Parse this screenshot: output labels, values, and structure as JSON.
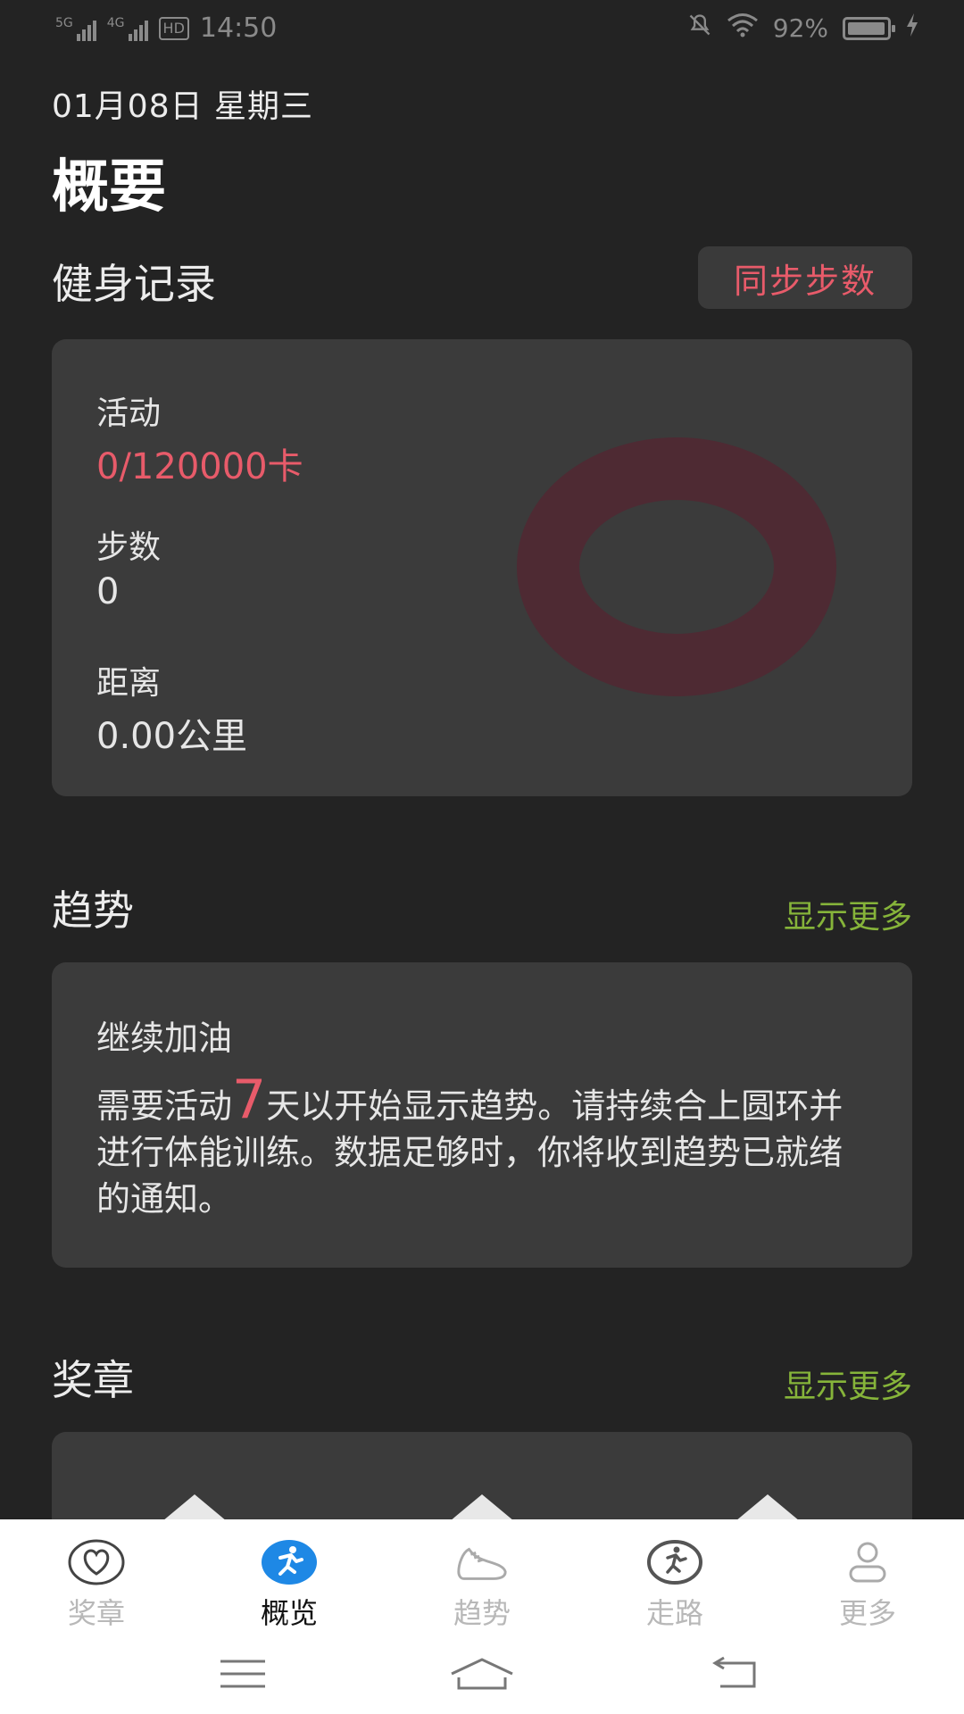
{
  "status_bar": {
    "time": "14:50",
    "network1": "5G",
    "network2": "4G",
    "hd": "HD",
    "battery": "92%"
  },
  "header": {
    "date": "01月08日  星期三",
    "title": "概要"
  },
  "fitness": {
    "section_title": "健身记录",
    "sync_button": "同步步数",
    "activity_label": "活动",
    "activity_value": "0/120000卡",
    "steps_label": "步数",
    "steps_value": "0",
    "distance_label": "距离",
    "distance_value": "0.00公里",
    "ring_color": "#4e2a33"
  },
  "trend": {
    "section_title": "趋势",
    "more_link": "显示更多",
    "card_title": "继续加油",
    "body_before": "需要活动",
    "body_number": "7",
    "body_after": "天以开始显示趋势。请持续合上圆环并进行体能训练。数据足够时，你将收到趋势已就绪的通知。"
  },
  "medals": {
    "section_title": "奖章",
    "more_link": "显示更多"
  },
  "tabbar": {
    "items": [
      {
        "label": "奖章",
        "icon": "heart-icon"
      },
      {
        "label": "概览",
        "icon": "runner-icon"
      },
      {
        "label": "趋势",
        "icon": "shoe-icon"
      },
      {
        "label": "走路",
        "icon": "walker-icon"
      },
      {
        "label": "更多",
        "icon": "person-icon"
      }
    ],
    "active_index": 1
  },
  "colors": {
    "accent_red": "#e85b6a",
    "accent_green": "#86b43a",
    "active_blue": "#1e88e5"
  }
}
